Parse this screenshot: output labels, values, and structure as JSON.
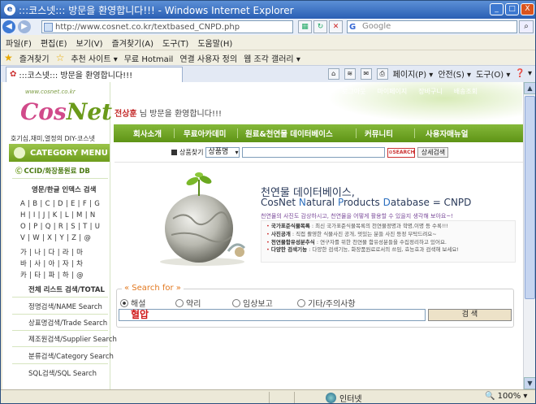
{
  "window": {
    "title": ":::코스넷::: 방문을 환영합니다!!! - Windows Internet Explorer",
    "min": "_",
    "max": "□",
    "close": "X"
  },
  "address": {
    "url": "http://www.cosnet.co.kr/textbased_CNPD.php",
    "search_placeholder": "Google"
  },
  "menubar": [
    "파일(F)",
    "편집(E)",
    "보기(V)",
    "즐겨찾기(A)",
    "도구(T)",
    "도움말(H)"
  ],
  "favbar": {
    "label": "즐겨찾기",
    "items": [
      "추천 사이트 ▾",
      "무료 Hotmail",
      "연결 사용자 정의",
      "웹 조각 갤러리 ▾"
    ]
  },
  "tab": {
    "label": ":::코스넷::: 방문을 환영합니다!!!"
  },
  "cmdbar": [
    "페이지(P) ▾",
    "안전(S) ▾",
    "도구(O) ▾",
    "❓ ▾"
  ],
  "site": {
    "logo_top": "www.cosnet.co.kr",
    "logo_co": "Cos",
    "logo_net": "Net",
    "logo_sub": "호기심,재미,열정의 DIY-코스넷",
    "category_menu": "CATEGORY MENU",
    "ccid": "CCID/화장품원료 DB",
    "index_title": "영문/한글 인덱스 검색",
    "alpha_rows": [
      "A | B | C | D | E | F | G",
      "H | I | J | K | L | M | N",
      "O | P | Q | R | S | T | U",
      "V | W | X | Y | Z | @",
      "가 | 나 | 다 | 라 | 마",
      "바 | 사 | 아 | 자 | 차",
      "카 | 타 | 파 | 하 | @"
    ],
    "left_links": [
      "전체 리스트 검색/TOTAL",
      "정명검색/NAME Search",
      "상표명검색/Trade Search",
      "제조원검색/Supplier Search",
      "분류검색/Category Search",
      "SQL검색/SQL Search"
    ],
    "top_links": [
      "로그아웃",
      "마이페이지",
      "장바구니",
      "배송조회"
    ],
    "welcome_name": "전상훈",
    "welcome_text": " 님 방문을 환영합니다!!!",
    "gnb": [
      "회사소개",
      "무료아카데미",
      "원료&천연물 데이터베이스",
      "커뮤니티",
      "사용자매뉴얼"
    ],
    "search_label": "상품찾기",
    "search_select": "상품명",
    "search_btn": "⊙SEARCH",
    "detail_btn": "상세검색"
  },
  "hero": {
    "title": "천연물 데이터베이스,",
    "title2_parts": [
      "Co",
      "sNet ",
      "N",
      "atural ",
      "P",
      "roducts ",
      "D",
      "atabase = CNPD"
    ],
    "subtitle": "천연물의 사진도 감상하시고, 천연물을 어떻게 활용할 수 있을지 생각해 보아요~!",
    "info": [
      {
        "head": "국가표준식물목록",
        "body": " : 최신 국가표준식물목록의 천연물정명과 학명,이명 등 수록!!!"
      },
      {
        "head": "사진공개",
        "body": " : 직접 촬영한 식물사진 공개, 멋있는 분들 사진 등정 부탁드려요~"
      },
      {
        "head": "천연물함유성분추식",
        "body": " : 연구자를 위한 천연물 함유성분들을 수집정리하고 있어요."
      },
      {
        "head": "다양한 검색기능",
        "body": " : 다양한 검색기능, 화장품원료로서의 쓰임, 효능효과 검색해 보세요!"
      }
    ]
  },
  "search": {
    "legend": "« Search for »",
    "options": [
      "해설",
      "약리",
      "임상보고",
      "기타/주의사항"
    ],
    "selected_index": 0,
    "query": "혈압",
    "button": "검 색"
  },
  "status": {
    "zone": "인터넷",
    "zoom": "🔍 100% ▾"
  }
}
